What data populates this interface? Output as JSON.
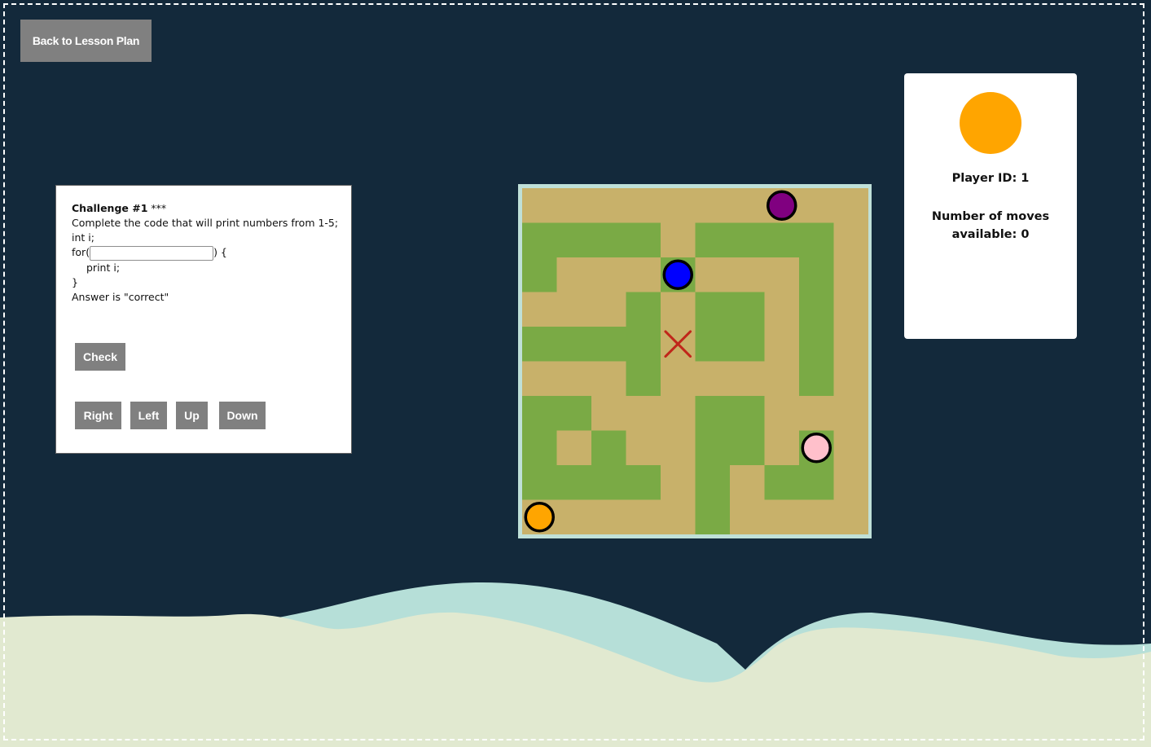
{
  "header": {
    "back_label": "Back to Lesson Plan"
  },
  "challenge": {
    "title": "Challenge #1",
    "difficulty": "***",
    "instruction": "Complete the code that will print numbers from 1-5;",
    "code_line1": "int i;",
    "for_prefix": "for(",
    "for_suffix": ") {",
    "body": "print i;",
    "closing": "}",
    "hint": "Answer is \"correct\"",
    "input_value": "",
    "check_label": "Check"
  },
  "controls": {
    "right": "Right",
    "left": "Left",
    "up": "Up",
    "down": "Down"
  },
  "player": {
    "id_text": "Player ID: 1",
    "moves_text": "Number of moves available: 0",
    "color": "#ffa500"
  },
  "maze": {
    "rows": 10,
    "cols": 10,
    "walls": [
      "..........",
      "xxxx.xxxx.",
      "x...x...x.",
      "...x.xx.x.",
      "xxxx.xx.x.",
      "...x....x.",
      "xx...xx...",
      "x.x..xx.x.",
      "xxxx.x.xx.",
      ".....x...."
    ],
    "target": {
      "row": 4,
      "col": 4
    },
    "players": [
      {
        "name": "purple",
        "color": "#800080",
        "row": 0,
        "col": 7
      },
      {
        "name": "blue",
        "color": "#0000ff",
        "row": 2,
        "col": 4
      },
      {
        "name": "pink",
        "color": "#ffc0cb",
        "row": 7,
        "col": 8
      },
      {
        "name": "orange",
        "color": "#ffa500",
        "row": 9,
        "col": 0
      }
    ]
  },
  "colors": {
    "background": "#13293b",
    "path": "#c8b16a",
    "grass": "#7aaa45",
    "target": "#c0261a",
    "ground": "#e1e9d0",
    "water": "#b6dfd8",
    "button": "#808080"
  }
}
